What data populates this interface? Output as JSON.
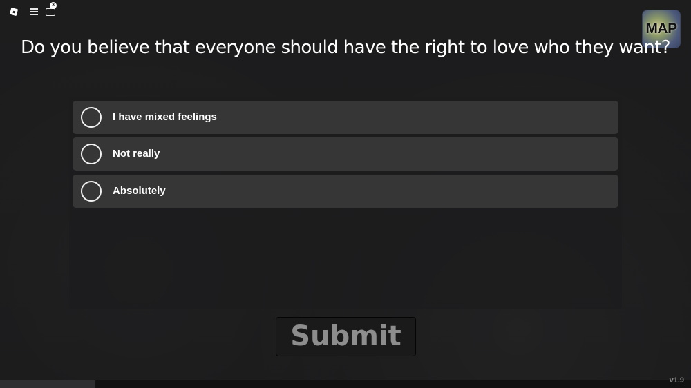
{
  "topbar": {
    "chat_badge_count": "3",
    "icons": [
      "roblox-logo-icon",
      "menu-icon",
      "chat-icon"
    ]
  },
  "map": {
    "label": "MAP"
  },
  "question": "Do you believe that everyone should have the right to love who they want?",
  "options": [
    {
      "label": "I have mixed feelings",
      "selected": false
    },
    {
      "label": "Not really",
      "selected": false
    },
    {
      "label": "Absolutely",
      "selected": false
    }
  ],
  "submit": {
    "label": "Submit",
    "enabled": false
  },
  "version": "v1.9",
  "colors": {
    "background": "#1c1c1d",
    "option_background": "#363637",
    "submit_text": "#8d8d8d"
  }
}
